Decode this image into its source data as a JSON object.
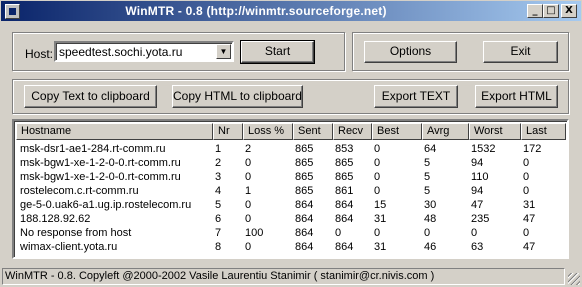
{
  "window": {
    "title": "WinMTR - 0.8 (http://winmtr.sourceforge.net)",
    "min_glyph": "_",
    "max_glyph": "□",
    "close_glyph": "X"
  },
  "host": {
    "label": "Host:",
    "value": "speedtest.sochi.yota.ru",
    "dropdown_glyph": "▼"
  },
  "buttons": {
    "start": "Start",
    "options": "Options",
    "exit": "Exit",
    "copy_text": "Copy Text to clipboard",
    "copy_html": "Copy HTML to clipboard",
    "export_text": "Export TEXT",
    "export_html": "Export HTML"
  },
  "table": {
    "columns": [
      "Hostname",
      "Nr",
      "Loss %",
      "Sent",
      "Recv",
      "Best",
      "Avrg",
      "Worst",
      "Last"
    ],
    "rows": [
      [
        "msk-dsr1-ae1-284.rt-comm.ru",
        "1",
        "2",
        "865",
        "853",
        "0",
        "64",
        "1532",
        "172"
      ],
      [
        "msk-bgw1-xe-1-2-0-0.rt-comm.ru",
        "2",
        "0",
        "865",
        "865",
        "0",
        "5",
        "94",
        "0"
      ],
      [
        "msk-bgw1-xe-1-2-0-0.rt-comm.ru",
        "3",
        "0",
        "865",
        "865",
        "0",
        "5",
        "110",
        "0"
      ],
      [
        "rostelecom.c.rt-comm.ru",
        "4",
        "1",
        "865",
        "861",
        "0",
        "5",
        "94",
        "0"
      ],
      [
        "ge-5-0.uak6-a1.ug.ip.rostelecom.ru",
        "5",
        "0",
        "864",
        "864",
        "15",
        "30",
        "47",
        "31"
      ],
      [
        "188.128.92.62",
        "6",
        "0",
        "864",
        "864",
        "31",
        "48",
        "235",
        "47"
      ],
      [
        "No response from host",
        "7",
        "100",
        "864",
        "0",
        "0",
        "0",
        "0",
        "0"
      ],
      [
        "wimax-client.yota.ru",
        "8",
        "0",
        "864",
        "864",
        "31",
        "46",
        "63",
        "47"
      ]
    ]
  },
  "status": {
    "text": "WinMTR - 0.8. Copyleft @2000-2002 Vasile Laurentiu Stanimir  ( stanimir@cr.nivis.com )"
  }
}
